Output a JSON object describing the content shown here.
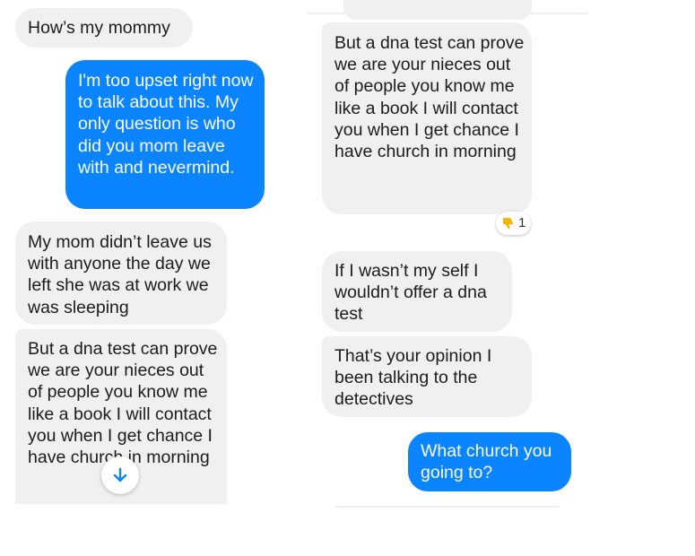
{
  "colors": {
    "outgoing_bubble": "#0a84ff",
    "incoming_bubble": "#f0f0f0",
    "reaction_emoji": "#f5b400",
    "scroll_arrow": "#0a84ff"
  },
  "left_panel": {
    "messages": [
      {
        "direction": "incoming",
        "text": "How’s my mommy"
      },
      {
        "direction": "outgoing",
        "text": "I'm too upset right now to talk about this. My only question is who did you mom leave with and nevermind."
      },
      {
        "direction": "incoming",
        "text": "My mom didn’t leave us with anyone the day we left she was at work we was sleeping"
      },
      {
        "direction": "incoming",
        "text": "But a dna test can prove we are your nieces out of people you know me like a book I will contact you when I get chance I have church in morning"
      }
    ],
    "scroll_button": {
      "icon": "arrow-down-icon"
    }
  },
  "right_panel": {
    "messages": [
      {
        "direction": "incoming",
        "text": "But a dna test can prove we are your nieces out of people you know me like a book I will contact you when I get chance I have church in morning"
      },
      {
        "direction": "incoming",
        "text": "If I wasn’t my self I wouldn’t offer a dna test"
      },
      {
        "direction": "incoming",
        "text": "That’s your opinion I been talking to the detectives"
      },
      {
        "direction": "outgoing",
        "text": "What church you going to?"
      }
    ],
    "reaction": {
      "icon": "thumbs-down-icon",
      "count": "1"
    }
  }
}
